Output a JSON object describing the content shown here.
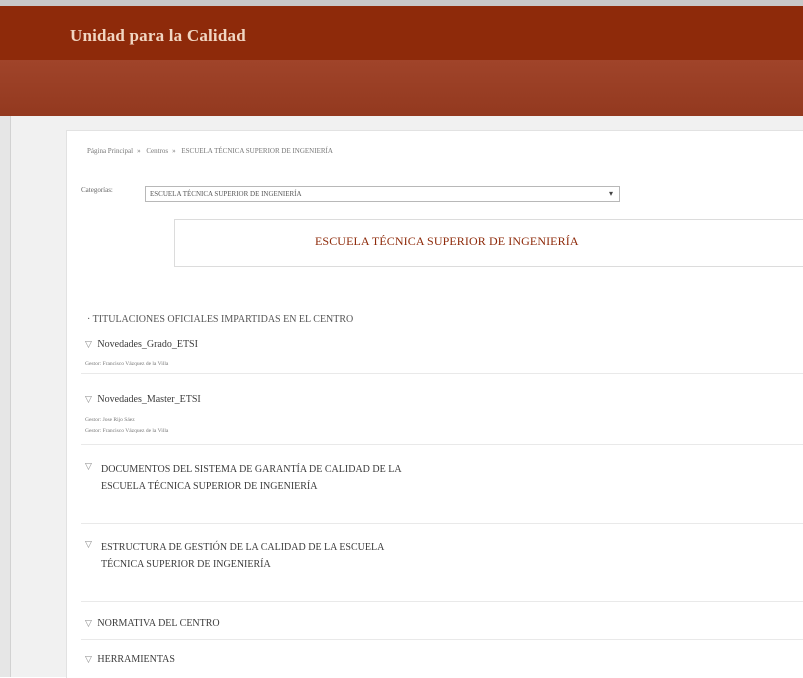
{
  "site": {
    "title": "Unidad para la Calidad"
  },
  "breadcrumb": [
    "Página Principal",
    "Centros",
    "ESCUELA TÉCNICA SUPERIOR DE INGENIERÍA"
  ],
  "category_filter": {
    "label": "Categorías:",
    "selected": "ESCUELA TÉCNICA SUPERIOR DE INGENIERÍA"
  },
  "category_title": "ESCUELA TÉCNICA SUPERIOR DE INGENIERÍA",
  "section_heading": "TITULACIONES OFICIALES IMPARTIDAS EN EL CENTRO",
  "items": [
    {
      "label": "Novedades_Grado_ETSI",
      "meta": [
        "Gestor: Francisco Vázquez de la Villa"
      ]
    },
    {
      "label": "Novedades_Master_ETSI",
      "meta": [
        "Gestor: Jose Rijo Sáez",
        "Gestor: Francisco Vázquez de la Villa"
      ]
    },
    {
      "label": "DOCUMENTOS DEL SISTEMA DE GARANTÍA DE CALIDAD DE LA ESCUELA TÉCNICA SUPERIOR DE INGENIERÍA"
    },
    {
      "label": "ESTRUCTURA DE GESTIÓN DE LA CALIDAD DE LA ESCUELA TÉCNICA SUPERIOR DE INGENIERÍA"
    },
    {
      "label": "NORMATIVA DEL CENTRO"
    },
    {
      "label": "HERRAMIENTAS"
    }
  ],
  "icons": {
    "collapse": "triangle-down-icon",
    "dropdown": "caret-down-icon"
  },
  "colors": {
    "brand": "#8e2a0a",
    "subbar": "#9a3d22",
    "title_text": "#8e2a0a"
  }
}
